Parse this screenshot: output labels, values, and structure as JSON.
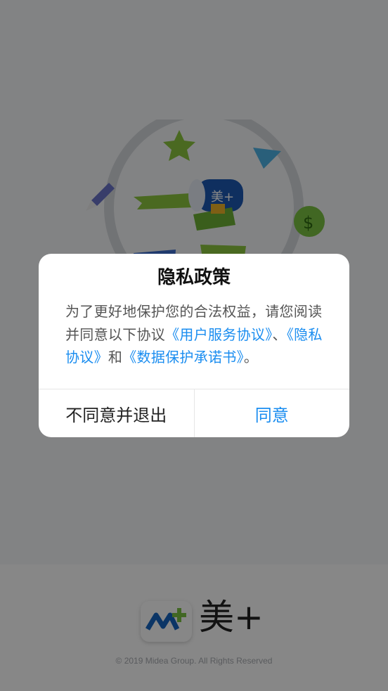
{
  "brand": {
    "name": "美+",
    "logo_icon": "midea-plus-logo-icon",
    "copyright": "© 2019 Midea Group. All Rights Reserved"
  },
  "illustration": {
    "icon": "splash-illustration-icon",
    "badge_text": "美+",
    "coin_text": "$"
  },
  "dialog": {
    "title": "隐私政策",
    "message_part1": "为了更好地保护您的合法权益，请您阅读并同意以下协议",
    "link_user_agreement": "《用户服务协议》",
    "sep1": "、",
    "link_privacy": "《隐私协议》",
    "sep2": "和",
    "link_data_protection": "《数据保护承诺书》",
    "sep3": "。",
    "decline_label": "不同意并退出",
    "accept_label": "同意"
  },
  "colors": {
    "link": "#1a8df0",
    "overlay": "rgba(0,0,0,0.47)",
    "brand_blue": "#1565c0",
    "brand_green": "#7cc242"
  }
}
